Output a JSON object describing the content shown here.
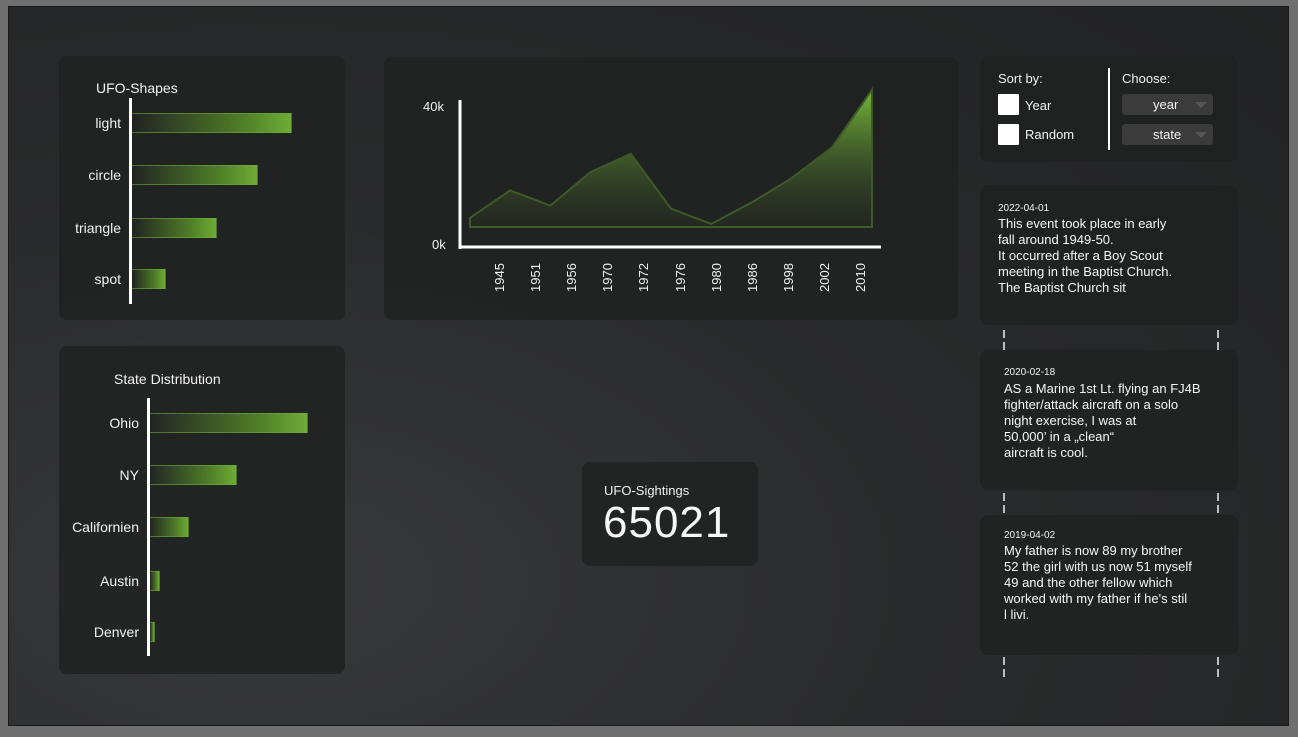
{
  "shapes": {
    "title": "UFO-Shapes",
    "items": [
      {
        "label": "light",
        "value": 0.94
      },
      {
        "label": "circle",
        "value": 0.74
      },
      {
        "label": "triangle",
        "value": 0.5
      },
      {
        "label": "spot",
        "value": 0.2
      }
    ]
  },
  "states": {
    "title": "State Distribution",
    "items": [
      {
        "label": "Ohio",
        "value": 0.94
      },
      {
        "label": "NY",
        "value": 0.52
      },
      {
        "label": "Californien",
        "value": 0.23
      },
      {
        "label": "Austin",
        "value": 0.06
      },
      {
        "label": "Denver",
        "value": 0.03
      }
    ]
  },
  "chart_data": {
    "type": "area",
    "x": [
      "1945",
      "1951",
      "1956",
      "1970",
      "1972",
      "1976",
      "1980",
      "1986",
      "1998",
      "2002",
      "2010"
    ],
    "y_label_top": "40k",
    "y_label_bottom": "0k",
    "ylim": [
      0,
      40000
    ],
    "values": [
      3000,
      12000,
      7000,
      18000,
      24000,
      6000,
      1000,
      8000,
      16000,
      26000,
      45000
    ],
    "accent": "#76b83a"
  },
  "controls": {
    "sort_title": "Sort by:",
    "sort_options": [
      "Year",
      "Random"
    ],
    "choose_title": "Choose:",
    "selects": [
      "year",
      "state"
    ]
  },
  "reports": [
    {
      "date": "2022-04-01",
      "text": "This event took place in early\nfall around 1949-50.\nIt occurred after a Boy Scout\nmeeting in the Baptist Church.\nThe Baptist Church sit"
    },
    {
      "date": "2020-02-18",
      "text": "AS a Marine 1st Lt. flying an FJ4B\nfighter/attack aircraft on a solo\nnight exercise, I was at\n50,000’ in a „clean“\naircraft is cool."
    },
    {
      "date": "2019-04-02",
      "text": "My father is now 89 my brother\n52 the girl with us now 51 myself\n49 and the other fellow which\nworked with my father if he's stil\nl livi."
    }
  ],
  "counter": {
    "label": "UFO-Sightings",
    "value": "65021"
  }
}
